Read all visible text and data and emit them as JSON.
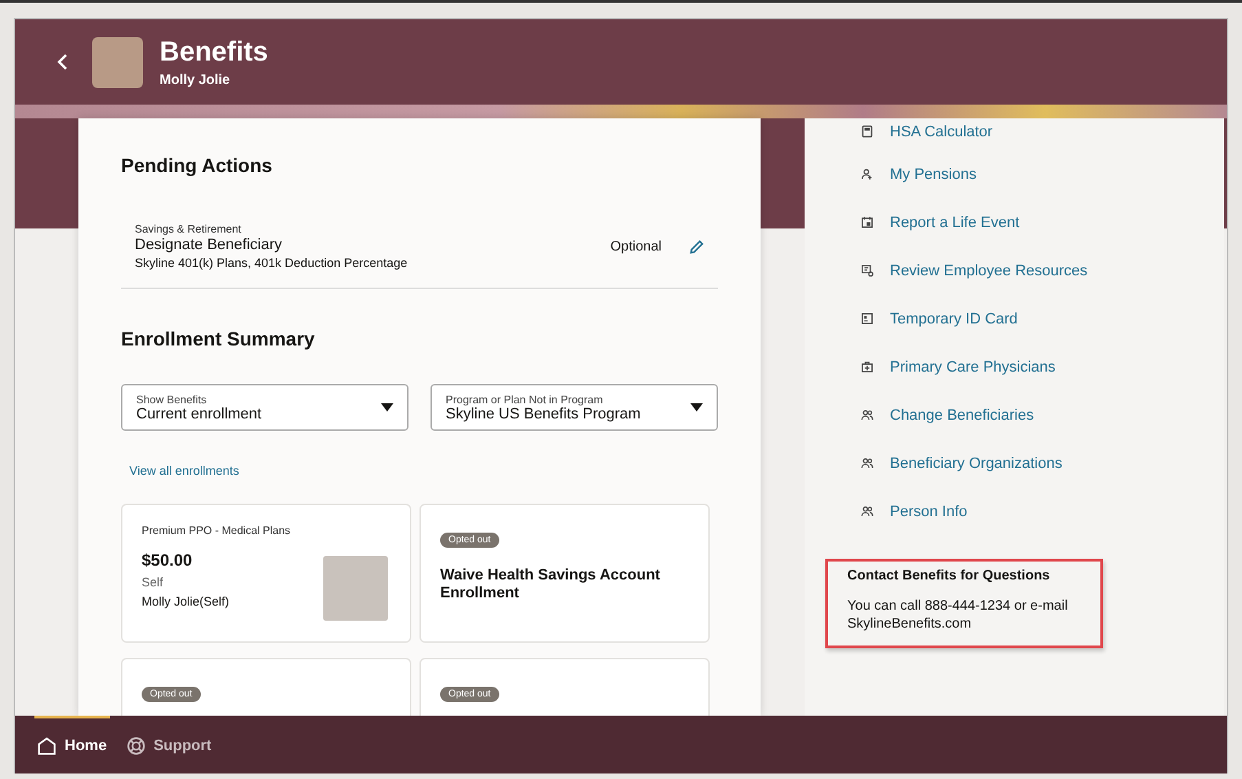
{
  "header": {
    "title": "Benefits",
    "subtitle": "Molly Jolie"
  },
  "pending_actions": {
    "title": "Pending Actions",
    "items": [
      {
        "category": "Savings & Retirement",
        "name": "Designate Beneficiary",
        "detail": "Skyline 401(k) Plans, 401k Deduction Percentage",
        "status": "Optional"
      }
    ]
  },
  "enrollment_summary": {
    "title": "Enrollment Summary",
    "filters": [
      {
        "label": "Show Benefits",
        "value": "Current enrollment"
      },
      {
        "label": "Program or Plan Not in Program",
        "value": "Skyline US Benefits Program"
      }
    ],
    "link": "View all enrollments",
    "cards": [
      {
        "kind": "plan",
        "plan": "Premium PPO - Medical Plans",
        "amount": "$50.00",
        "coverage": "Self",
        "participant": "Molly Jolie(Self)"
      },
      {
        "kind": "opted_out",
        "badge": "Opted out",
        "title": "Waive Health Savings Account Enrollment"
      },
      {
        "kind": "opted_out",
        "badge": "Opted out"
      },
      {
        "kind": "opted_out",
        "badge": "Opted out"
      }
    ]
  },
  "quick_links": [
    {
      "kind": "calculator",
      "label": "HSA Calculator"
    },
    {
      "kind": "person",
      "label": "My Pensions"
    },
    {
      "kind": "calendar",
      "label": "Report a Life Event"
    },
    {
      "kind": "resources",
      "label": "Review Employee Resources"
    },
    {
      "kind": "card",
      "label": "Temporary ID Card"
    },
    {
      "kind": "medical",
      "label": "Primary Care Physicians"
    },
    {
      "kind": "people",
      "label": "Change Beneficiaries"
    },
    {
      "kind": "people",
      "label": "Beneficiary Organizations"
    },
    {
      "kind": "people",
      "label": "Person Info"
    }
  ],
  "contact": {
    "title": "Contact Benefits for Questions",
    "text": "You can call 888-444-1234 or e-mail SkylineBenefits.com"
  },
  "bottom_nav": [
    {
      "kind": "home",
      "label": "Home",
      "selected": true
    },
    {
      "kind": "support",
      "label": "Support",
      "selected": false
    }
  ]
}
